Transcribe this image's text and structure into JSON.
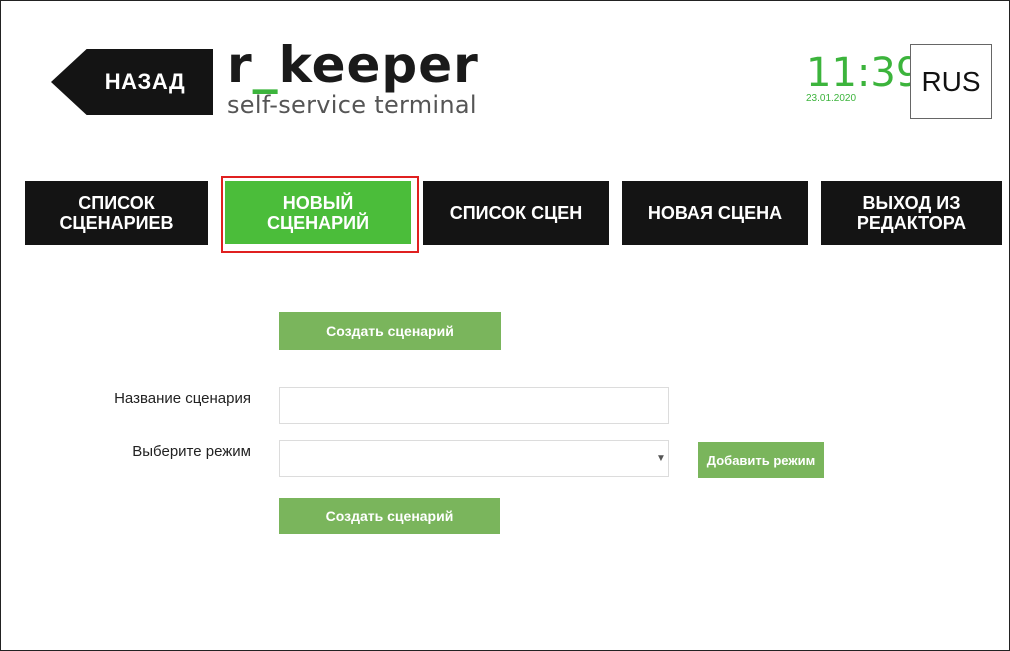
{
  "header": {
    "back_label": "НАЗАД",
    "logo_prefix": "r",
    "logo_underscore": "_",
    "logo_suffix": "keeper",
    "logo_subtitle": "self-service terminal",
    "time": "11:39",
    "date": "23.01.2020",
    "language": "RUS"
  },
  "nav": {
    "tabs": [
      {
        "line1": "СПИСОК",
        "line2": "СЦЕНАРИЕВ",
        "active": false
      },
      {
        "line1": "НОВЫЙ",
        "line2": "СЦЕНАРИЙ",
        "active": true
      },
      {
        "line1": "СПИСОК СЦЕН",
        "line2": "",
        "active": false
      },
      {
        "line1": "НОВАЯ СЦЕНА",
        "line2": "",
        "active": false
      },
      {
        "line1": "ВЫХОД ИЗ",
        "line2": "РЕДАКТОРА",
        "active": false
      }
    ]
  },
  "form": {
    "top_create_label": "Создать сценарий",
    "name_label": "Название сценария",
    "name_value": "",
    "mode_label": "Выберите режим",
    "mode_value": "",
    "add_mode_label": "Добавить режим",
    "bottom_create_label": "Создать сценарий"
  },
  "colors": {
    "accent_green": "#4bbd3a",
    "button_green": "#7ab55c",
    "dark": "#141414",
    "highlight_red": "#e02020"
  }
}
